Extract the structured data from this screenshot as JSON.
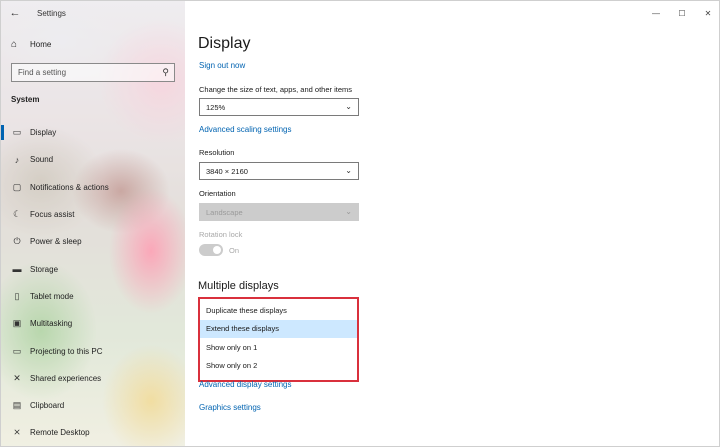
{
  "window": {
    "title": "Settings",
    "controls": {
      "minimize": "—",
      "maximize": "☐",
      "close": "✕"
    }
  },
  "sidebar": {
    "home_label": "Home",
    "search_placeholder": "Find a setting",
    "section_label": "System",
    "items": [
      {
        "label": "Display",
        "icon": "monitor-icon",
        "glyph": "▭"
      },
      {
        "label": "Sound",
        "icon": "speaker-icon",
        "glyph": "♪"
      },
      {
        "label": "Notifications & actions",
        "icon": "notifications-icon",
        "glyph": "▢"
      },
      {
        "label": "Focus assist",
        "icon": "moon-icon",
        "glyph": "☾"
      },
      {
        "label": "Power & sleep",
        "icon": "power-icon",
        "glyph": "⏻"
      },
      {
        "label": "Storage",
        "icon": "storage-icon",
        "glyph": "▬"
      },
      {
        "label": "Tablet mode",
        "icon": "tablet-icon",
        "glyph": "▯"
      },
      {
        "label": "Multitasking",
        "icon": "multitasking-icon",
        "glyph": "▣"
      },
      {
        "label": "Projecting to this PC",
        "icon": "projecting-icon",
        "glyph": "▭"
      },
      {
        "label": "Shared experiences",
        "icon": "shared-experiences-icon",
        "glyph": "✕"
      },
      {
        "label": "Clipboard",
        "icon": "clipboard-icon",
        "glyph": "▤"
      },
      {
        "label": "Remote Desktop",
        "icon": "remote-desktop-icon",
        "glyph": "⨯"
      }
    ]
  },
  "main": {
    "title": "Display",
    "sign_out": "Sign out now",
    "scale": {
      "label": "Change the size of text, apps, and other items",
      "value": "125%",
      "advanced_link": "Advanced scaling settings"
    },
    "resolution": {
      "label": "Resolution",
      "value": "3840 × 2160"
    },
    "orientation": {
      "label": "Orientation",
      "value": "Landscape"
    },
    "rotation_lock": {
      "label": "Rotation lock",
      "state": "On"
    },
    "multiple_displays": {
      "heading": "Multiple displays",
      "options": [
        "Duplicate these displays",
        "Extend these displays",
        "Show only on 1",
        "Show only on 2"
      ],
      "selected": "Extend these displays"
    },
    "advanced_display_link": "Advanced display settings",
    "graphics_link": "Graphics settings"
  }
}
